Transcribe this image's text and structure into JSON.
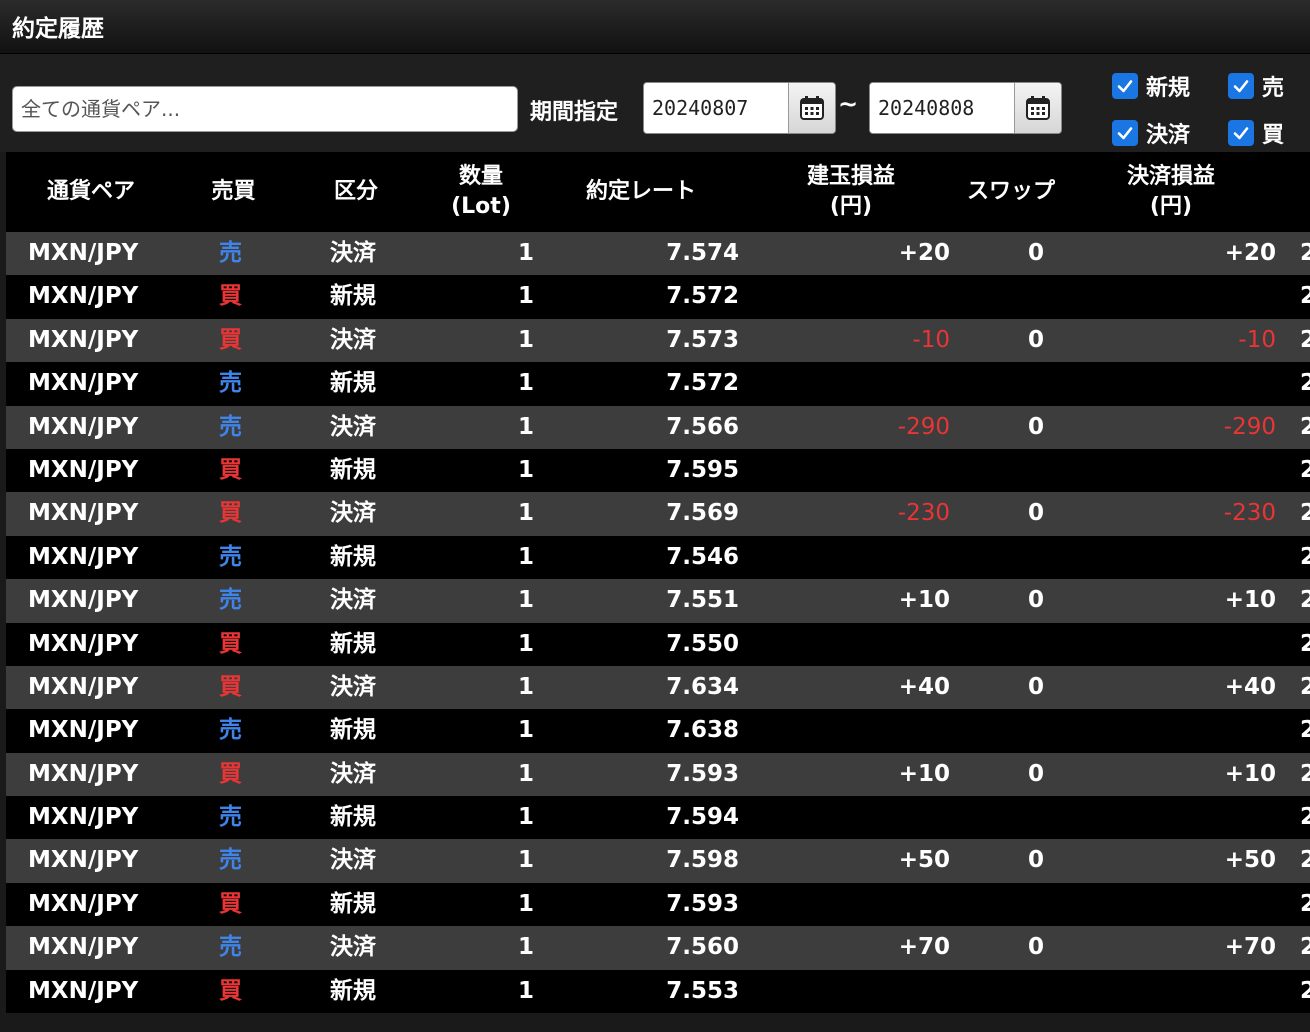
{
  "window": {
    "title": "約定履歴"
  },
  "filter": {
    "pair_placeholder": "全ての通貨ペア...",
    "period_label": "期間指定",
    "date_from": "20240807",
    "date_separator": "~",
    "date_to": "20240808",
    "checkboxes": {
      "new": {
        "label": "新規",
        "checked": true
      },
      "sell": {
        "label": "売",
        "checked": true
      },
      "settle": {
        "label": "決済",
        "checked": true
      },
      "buy": {
        "label": "買",
        "checked": true
      }
    }
  },
  "table": {
    "headers": {
      "pair": "通貨ペア",
      "side": "売買",
      "type": "区分",
      "qty": "数量\n(Lot)",
      "rate": "約定レート",
      "position_pl": "建玉損益\n(円)",
      "swap": "スワップ",
      "realized_pl": "決済損益\n(円)"
    },
    "rows": [
      {
        "pair": "MXN/JPY",
        "side": "売",
        "type": "決済",
        "qty": "1",
        "rate": "7.574",
        "pl": "+20",
        "swap": "0",
        "rpl": "+20",
        "cut": "2"
      },
      {
        "pair": "MXN/JPY",
        "side": "買",
        "type": "新規",
        "qty": "1",
        "rate": "7.572",
        "pl": "",
        "swap": "",
        "rpl": "",
        "cut": "2"
      },
      {
        "pair": "MXN/JPY",
        "side": "買",
        "type": "決済",
        "qty": "1",
        "rate": "7.573",
        "pl": "-10",
        "swap": "0",
        "rpl": "-10",
        "cut": "2"
      },
      {
        "pair": "MXN/JPY",
        "side": "売",
        "type": "新規",
        "qty": "1",
        "rate": "7.572",
        "pl": "",
        "swap": "",
        "rpl": "",
        "cut": "2"
      },
      {
        "pair": "MXN/JPY",
        "side": "売",
        "type": "決済",
        "qty": "1",
        "rate": "7.566",
        "pl": "-290",
        "swap": "0",
        "rpl": "-290",
        "cut": "2"
      },
      {
        "pair": "MXN/JPY",
        "side": "買",
        "type": "新規",
        "qty": "1",
        "rate": "7.595",
        "pl": "",
        "swap": "",
        "rpl": "",
        "cut": "2"
      },
      {
        "pair": "MXN/JPY",
        "side": "買",
        "type": "決済",
        "qty": "1",
        "rate": "7.569",
        "pl": "-230",
        "swap": "0",
        "rpl": "-230",
        "cut": "2"
      },
      {
        "pair": "MXN/JPY",
        "side": "売",
        "type": "新規",
        "qty": "1",
        "rate": "7.546",
        "pl": "",
        "swap": "",
        "rpl": "",
        "cut": "2"
      },
      {
        "pair": "MXN/JPY",
        "side": "売",
        "type": "決済",
        "qty": "1",
        "rate": "7.551",
        "pl": "+10",
        "swap": "0",
        "rpl": "+10",
        "cut": "2"
      },
      {
        "pair": "MXN/JPY",
        "side": "買",
        "type": "新規",
        "qty": "1",
        "rate": "7.550",
        "pl": "",
        "swap": "",
        "rpl": "",
        "cut": "2"
      },
      {
        "pair": "MXN/JPY",
        "side": "買",
        "type": "決済",
        "qty": "1",
        "rate": "7.634",
        "pl": "+40",
        "swap": "0",
        "rpl": "+40",
        "cut": "2"
      },
      {
        "pair": "MXN/JPY",
        "side": "売",
        "type": "新規",
        "qty": "1",
        "rate": "7.638",
        "pl": "",
        "swap": "",
        "rpl": "",
        "cut": "2"
      },
      {
        "pair": "MXN/JPY",
        "side": "買",
        "type": "決済",
        "qty": "1",
        "rate": "7.593",
        "pl": "+10",
        "swap": "0",
        "rpl": "+10",
        "cut": "2"
      },
      {
        "pair": "MXN/JPY",
        "side": "売",
        "type": "新規",
        "qty": "1",
        "rate": "7.594",
        "pl": "",
        "swap": "",
        "rpl": "",
        "cut": "2"
      },
      {
        "pair": "MXN/JPY",
        "side": "売",
        "type": "決済",
        "qty": "1",
        "rate": "7.598",
        "pl": "+50",
        "swap": "0",
        "rpl": "+50",
        "cut": "2"
      },
      {
        "pair": "MXN/JPY",
        "side": "買",
        "type": "新規",
        "qty": "1",
        "rate": "7.593",
        "pl": "",
        "swap": "",
        "rpl": "",
        "cut": "2"
      },
      {
        "pair": "MXN/JPY",
        "side": "売",
        "type": "決済",
        "qty": "1",
        "rate": "7.560",
        "pl": "+70",
        "swap": "0",
        "rpl": "+70",
        "cut": "2"
      },
      {
        "pair": "MXN/JPY",
        "side": "買",
        "type": "新規",
        "qty": "1",
        "rate": "7.553",
        "pl": "",
        "swap": "",
        "rpl": "",
        "cut": "2"
      }
    ]
  },
  "colors": {
    "sell": "#3f84e8",
    "buy": "#e83535",
    "loss": "#e83535",
    "checkbox": "#1976e3",
    "row_odd": "#3d3d3d",
    "row_even": "#000000"
  },
  "icons": {
    "calendar": "calendar-icon",
    "check": "check-icon"
  }
}
